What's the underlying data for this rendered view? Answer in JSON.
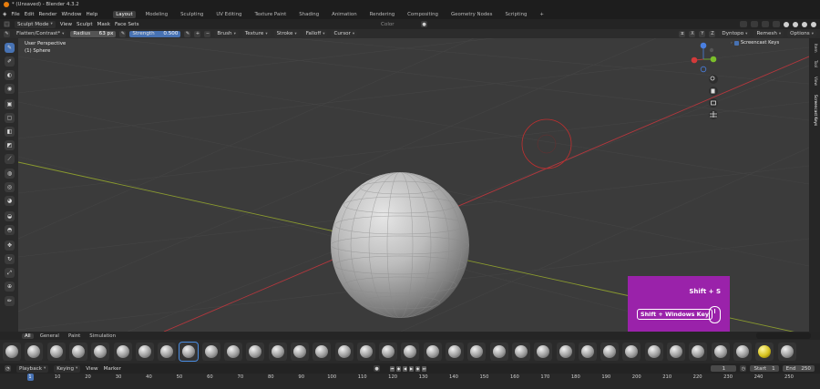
{
  "window": {
    "title": "* (Unsaved) - Blender 4.3.2"
  },
  "menu": [
    "File",
    "Edit",
    "Render",
    "Window",
    "Help"
  ],
  "workspaces": [
    "Layout",
    "Modeling",
    "Sculpting",
    "UV Editing",
    "Texture Paint",
    "Shading",
    "Animation",
    "Rendering",
    "Compositing",
    "Geometry Nodes",
    "Scripting"
  ],
  "workspace_active": "Layout",
  "workspace_add": "+",
  "header2": {
    "mode": "Sculpt Mode",
    "items": [
      "View",
      "Sculpt",
      "Mask",
      "Face Sets"
    ],
    "color_label": "Color"
  },
  "tool_settings": {
    "brush_name": "Flatten/Contrast*",
    "radius_label": "Radius",
    "radius_value": "63 px",
    "strength_label": "Strength",
    "strength_value": "0.500",
    "menus": [
      "Brush",
      "Texture",
      "Stroke",
      "Falloff",
      "Cursor"
    ],
    "axis": [
      "X",
      "Y",
      "Z"
    ],
    "right_menus": [
      "Dyntopo",
      "Remesh",
      "Options"
    ]
  },
  "viewport": {
    "perspective": "User Perspective",
    "object": "(1) Sphere",
    "screencast_label": "Screencast Keys"
  },
  "npanel_tabs": [
    "Item",
    "Tool",
    "View",
    "Screencast Keys"
  ],
  "key_overlay": {
    "key1": "Shift + S",
    "key2": "Shift + Windows Key",
    "bg_color": "#9a22aa"
  },
  "asset_tabs": [
    "All",
    "General",
    "Paint",
    "Simulation"
  ],
  "timeline": {
    "menus": [
      "Playback",
      "Keying",
      "View",
      "Marker"
    ],
    "current_frame": "1",
    "start_label": "Start",
    "start": "1",
    "end_label": "End",
    "end": "250",
    "ticks": [
      "1",
      "10",
      "20",
      "30",
      "40",
      "50",
      "60",
      "70",
      "80",
      "90",
      "100",
      "110",
      "120",
      "130",
      "140",
      "150",
      "160",
      "170",
      "180",
      "190",
      "200",
      "210",
      "220",
      "230",
      "240",
      "250"
    ]
  },
  "colors": {
    "accent": "#4772b3",
    "x_axis": "#b5373d",
    "y_axis": "#8a9a2f"
  }
}
